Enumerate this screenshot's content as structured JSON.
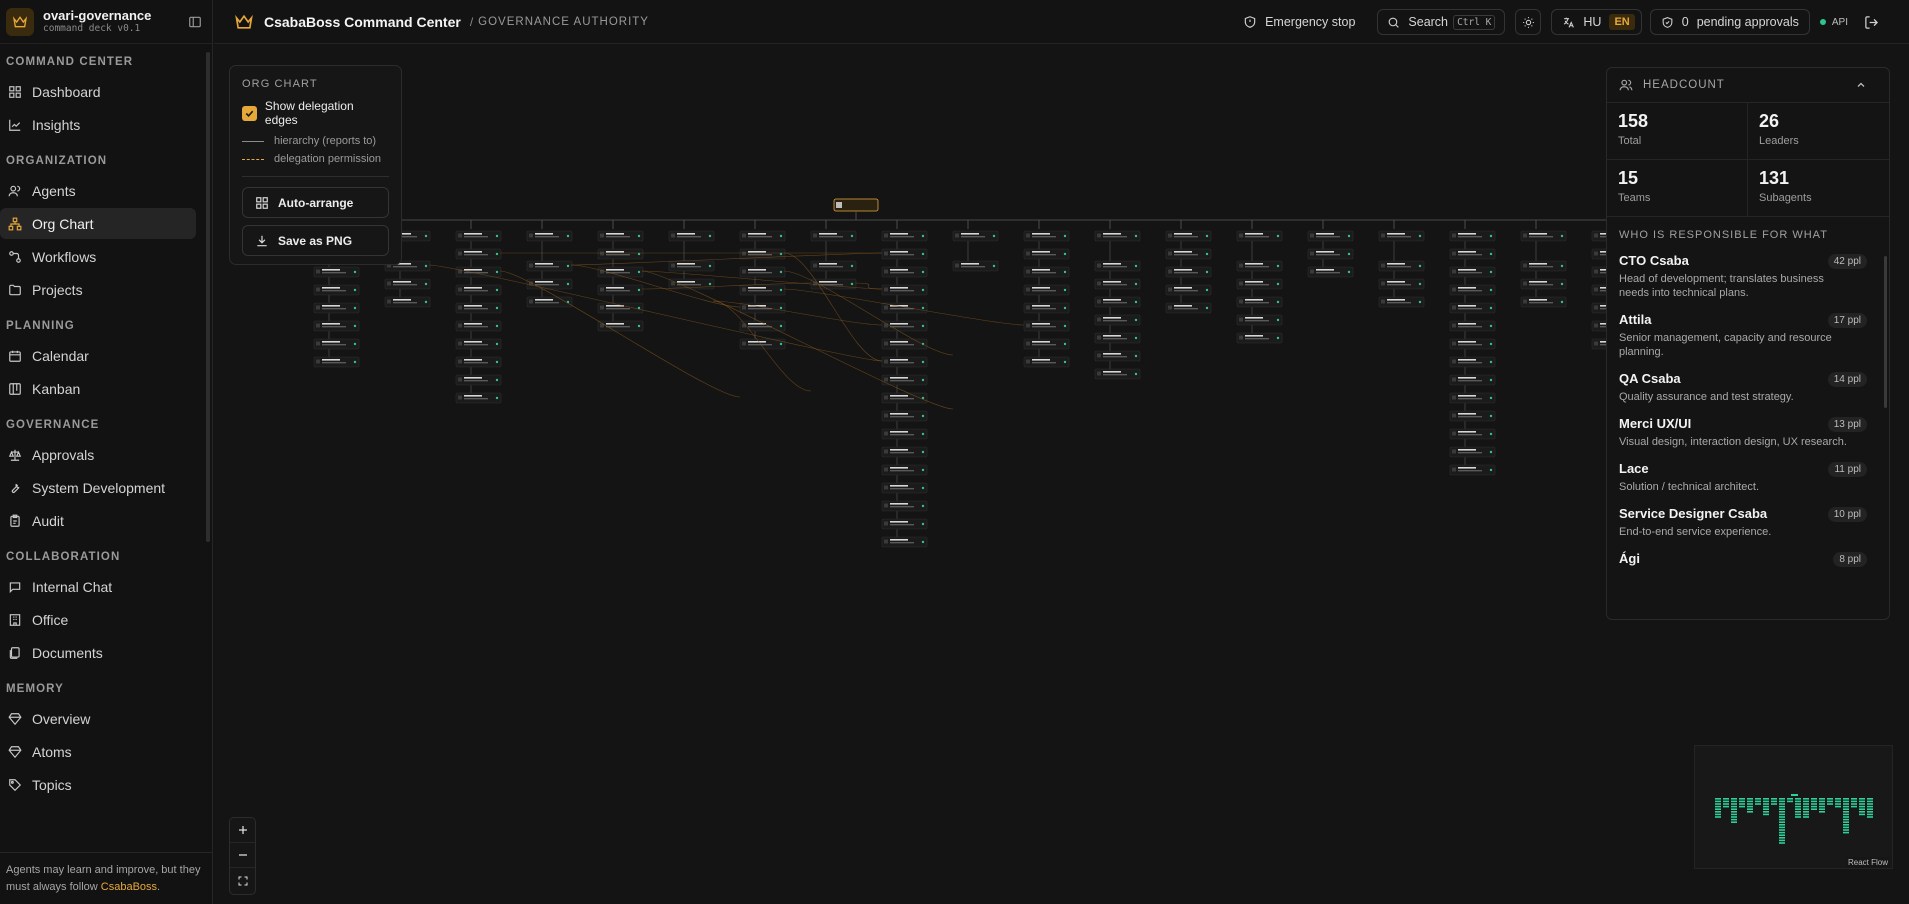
{
  "sidebar": {
    "brand_name": "ovari-governance",
    "brand_sub": "command deck v0.1",
    "groups": [
      {
        "title": "COMMAND CENTER",
        "items": [
          {
            "label": "Dashboard",
            "icon": "grid-icon"
          },
          {
            "label": "Insights",
            "icon": "chart-line-icon"
          }
        ]
      },
      {
        "title": "ORGANIZATION",
        "items": [
          {
            "label": "Agents",
            "icon": "users-icon"
          },
          {
            "label": "Org Chart",
            "icon": "org-chart-icon",
            "active": true
          },
          {
            "label": "Workflows",
            "icon": "workflow-icon"
          },
          {
            "label": "Projects",
            "icon": "folder-icon"
          }
        ]
      },
      {
        "title": "PLANNING",
        "items": [
          {
            "label": "Calendar",
            "icon": "calendar-icon"
          },
          {
            "label": "Kanban",
            "icon": "kanban-icon"
          }
        ]
      },
      {
        "title": "GOVERNANCE",
        "items": [
          {
            "label": "Approvals",
            "icon": "scale-icon"
          },
          {
            "label": "System Development",
            "icon": "wrench-icon"
          },
          {
            "label": "Audit",
            "icon": "clipboard-icon"
          }
        ]
      },
      {
        "title": "COLLABORATION",
        "items": [
          {
            "label": "Internal Chat",
            "icon": "chat-icon"
          },
          {
            "label": "Office",
            "icon": "building-icon"
          },
          {
            "label": "Documents",
            "icon": "documents-icon"
          }
        ]
      },
      {
        "title": "MEMORY",
        "items": [
          {
            "label": "Overview",
            "icon": "gem-icon"
          },
          {
            "label": "Atoms",
            "icon": "gem-icon"
          },
          {
            "label": "Topics",
            "icon": "tag-icon"
          }
        ]
      }
    ],
    "footer_text": "Agents may learn and improve, but they must always follow ",
    "footer_brand": "CsabaBoss",
    "footer_end": "."
  },
  "header": {
    "title": "CsabaBoss Command Center",
    "separator": "/",
    "breadcrumb": "GOVERNANCE AUTHORITY",
    "emergency_label": "Emergency stop",
    "search_label": "Search",
    "search_kbd": "Ctrl K",
    "lang_hu": "HU",
    "lang_en": "EN",
    "approvals_count": "0",
    "approvals_label": "pending approvals",
    "api_label": "API"
  },
  "org_panel": {
    "title": "ORG CHART",
    "show_edges_label": "Show delegation edges",
    "show_edges_checked": true,
    "legend_hierarchy": "hierarchy (reports to)",
    "legend_delegation": "delegation permission",
    "auto_arrange_label": "Auto-arrange",
    "save_png_label": "Save as PNG"
  },
  "headcount": {
    "title": "HEADCOUNT",
    "stats": [
      {
        "value": "158",
        "label": "Total"
      },
      {
        "value": "26",
        "label": "Leaders"
      },
      {
        "value": "15",
        "label": "Teams"
      },
      {
        "value": "131",
        "label": "Subagents"
      }
    ],
    "resp_title": "WHO IS RESPONSIBLE FOR WHAT",
    "responsibilities": [
      {
        "name": "CTO Csaba",
        "count": "42 ppl",
        "desc": "Head of development; translates business needs into technical plans."
      },
      {
        "name": "Attila",
        "count": "17 ppl",
        "desc": "Senior management, capacity and resource planning."
      },
      {
        "name": "QA Csaba",
        "count": "14 ppl",
        "desc": "Quality assurance and test strategy."
      },
      {
        "name": "Merci UX/UI",
        "count": "13 ppl",
        "desc": "Visual design, interaction design, UX research."
      },
      {
        "name": "Lace",
        "count": "11 ppl",
        "desc": "Solution / technical architect."
      },
      {
        "name": "Service Designer Csaba",
        "count": "10 ppl",
        "desc": "End-to-end service experience."
      },
      {
        "name": "Ági",
        "count": "8 ppl",
        "desc": ""
      }
    ]
  },
  "canvas": {
    "attribution": "React Flow",
    "org_columns_depth": [
      8,
      4,
      10,
      4,
      6,
      3,
      7,
      3,
      18,
      2,
      8,
      8,
      5,
      6,
      3,
      4,
      14,
      4,
      7,
      8
    ],
    "colors": {
      "accent": "#e7a83a",
      "edge_hierarchy": "#5a5a5a",
      "edge_delegation": "#8a5a1c",
      "node_dot": "#30c48d",
      "minimap_node": "#2fcf9a"
    }
  }
}
